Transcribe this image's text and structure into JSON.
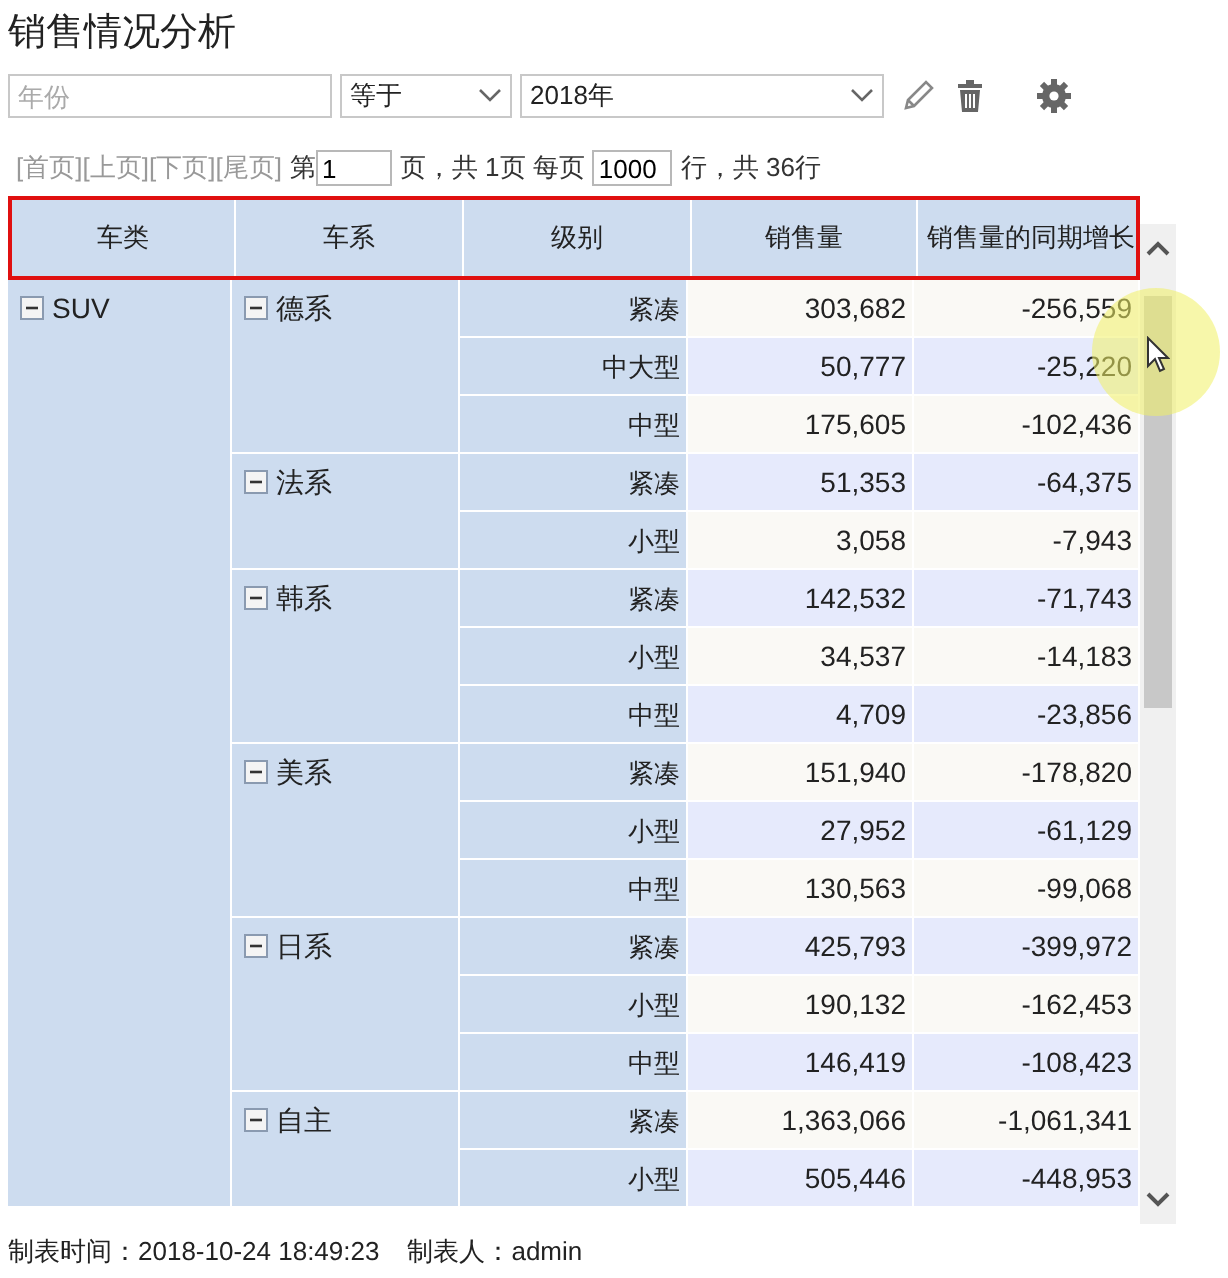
{
  "title": "销售情况分析",
  "filter": {
    "field_placeholder": "年份",
    "operator": "等于",
    "value": "2018年"
  },
  "pager": {
    "links": [
      "[首页]",
      "[上页]",
      "[下页]",
      "[尾页]"
    ],
    "page_prefix": "第",
    "page": "1",
    "page_text": "页，共 1页 每页",
    "page_size": "1000",
    "rows_text": "行，共 36行"
  },
  "table": {
    "columns": [
      "车类",
      "车系",
      "级别",
      "销售量",
      "销售量的同期增长"
    ],
    "categories": [
      {
        "name": "SUV",
        "expanded": true,
        "series": [
          {
            "name": "德系",
            "expanded": true,
            "rows": [
              {
                "level": "紧凑",
                "sales": "303,682",
                "growth": "-256,559"
              },
              {
                "level": "中大型",
                "sales": "50,777",
                "growth": "-25,220"
              },
              {
                "level": "中型",
                "sales": "175,605",
                "growth": "-102,436"
              }
            ]
          },
          {
            "name": "法系",
            "expanded": true,
            "rows": [
              {
                "level": "紧凑",
                "sales": "51,353",
                "growth": "-64,375"
              },
              {
                "level": "小型",
                "sales": "3,058",
                "growth": "-7,943"
              }
            ]
          },
          {
            "name": "韩系",
            "expanded": true,
            "rows": [
              {
                "level": "紧凑",
                "sales": "142,532",
                "growth": "-71,743"
              },
              {
                "level": "小型",
                "sales": "34,537",
                "growth": "-14,183"
              },
              {
                "level": "中型",
                "sales": "4,709",
                "growth": "-23,856"
              }
            ]
          },
          {
            "name": "美系",
            "expanded": true,
            "rows": [
              {
                "level": "紧凑",
                "sales": "151,940",
                "growth": "-178,820"
              },
              {
                "level": "小型",
                "sales": "27,952",
                "growth": "-61,129"
              },
              {
                "level": "中型",
                "sales": "130,563",
                "growth": "-99,068"
              }
            ]
          },
          {
            "name": "日系",
            "expanded": true,
            "rows": [
              {
                "level": "紧凑",
                "sales": "425,793",
                "growth": "-399,972"
              },
              {
                "level": "小型",
                "sales": "190,132",
                "growth": "-162,453"
              },
              {
                "level": "中型",
                "sales": "146,419",
                "growth": "-108,423"
              }
            ]
          },
          {
            "name": "自主",
            "expanded": true,
            "rows": [
              {
                "level": "紧凑",
                "sales": "1,363,066",
                "growth": "-1,061,341"
              },
              {
                "level": "小型",
                "sales": "505,446",
                "growth": "-448,953"
              }
            ]
          }
        ]
      }
    ]
  },
  "footer": {
    "created_time": "制表时间：2018-10-24 18:49:23",
    "creator": "制表人：admin"
  }
}
